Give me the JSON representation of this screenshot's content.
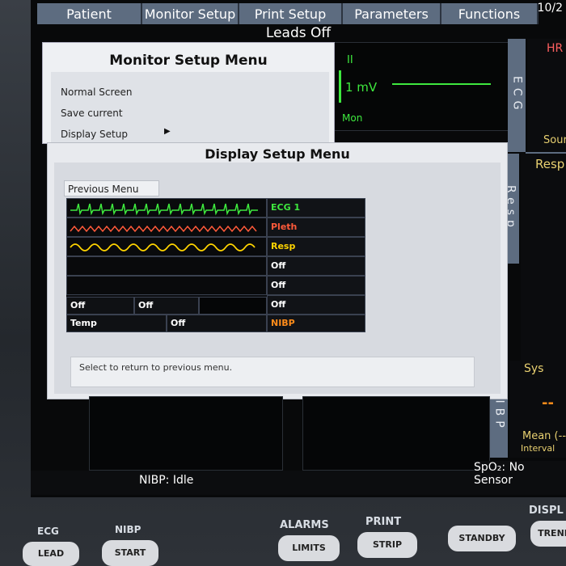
{
  "menubar": [
    "Patient",
    "Monitor Setup",
    "Print Setup",
    "Parameters",
    "Functions"
  ],
  "clock": "10/2",
  "status_top": "Leads Off",
  "ecg_panel": {
    "lead": "II",
    "scale": "1 mV",
    "mode": "Mon"
  },
  "side_tabs": {
    "ecg": "ECG",
    "resp": "Resp",
    "nibp": "NIBP"
  },
  "right_values": {
    "hr": "HR",
    "source": "Sour",
    "resp": "Resp",
    "sys": "Sys",
    "dashes": "--",
    "mean": "Mean (--",
    "interval": "Interval"
  },
  "monitor_setup": {
    "title": "Monitor Setup Menu",
    "items": [
      "Normal Screen",
      "Save current",
      "Display Setup"
    ]
  },
  "display_setup": {
    "title": "Display Setup Menu",
    "previous": "Previous Menu",
    "rows": [
      "ECG 1",
      "Pleth",
      "Resp",
      "Off",
      "Off",
      "Off"
    ],
    "row_colors": [
      "#3ee83e",
      "#ff5a3a",
      "#ffd400",
      "#ffffff",
      "#ffffff",
      "#ffffff"
    ],
    "off_left": "Off",
    "off_mid": "Off",
    "temp": "Temp",
    "temp_off": "Off",
    "nibp": "NIBP",
    "nibp_color": "#ff8c1a",
    "help": "Select to return to previous menu."
  },
  "status_bottom": {
    "nibp": "NIBP: Idle",
    "spo2": "SpO₂: No Sensor"
  },
  "hardware": {
    "ecg_label": "ECG",
    "lead": "LEAD",
    "nibp_label": "NIBP",
    "start": "START",
    "alarms_label": "ALARMS",
    "limits": "LIMITS",
    "print_label": "PRINT",
    "strip": "STRIP",
    "standby": "STANDBY",
    "display_label": "DISPL",
    "trend": "TREND"
  }
}
